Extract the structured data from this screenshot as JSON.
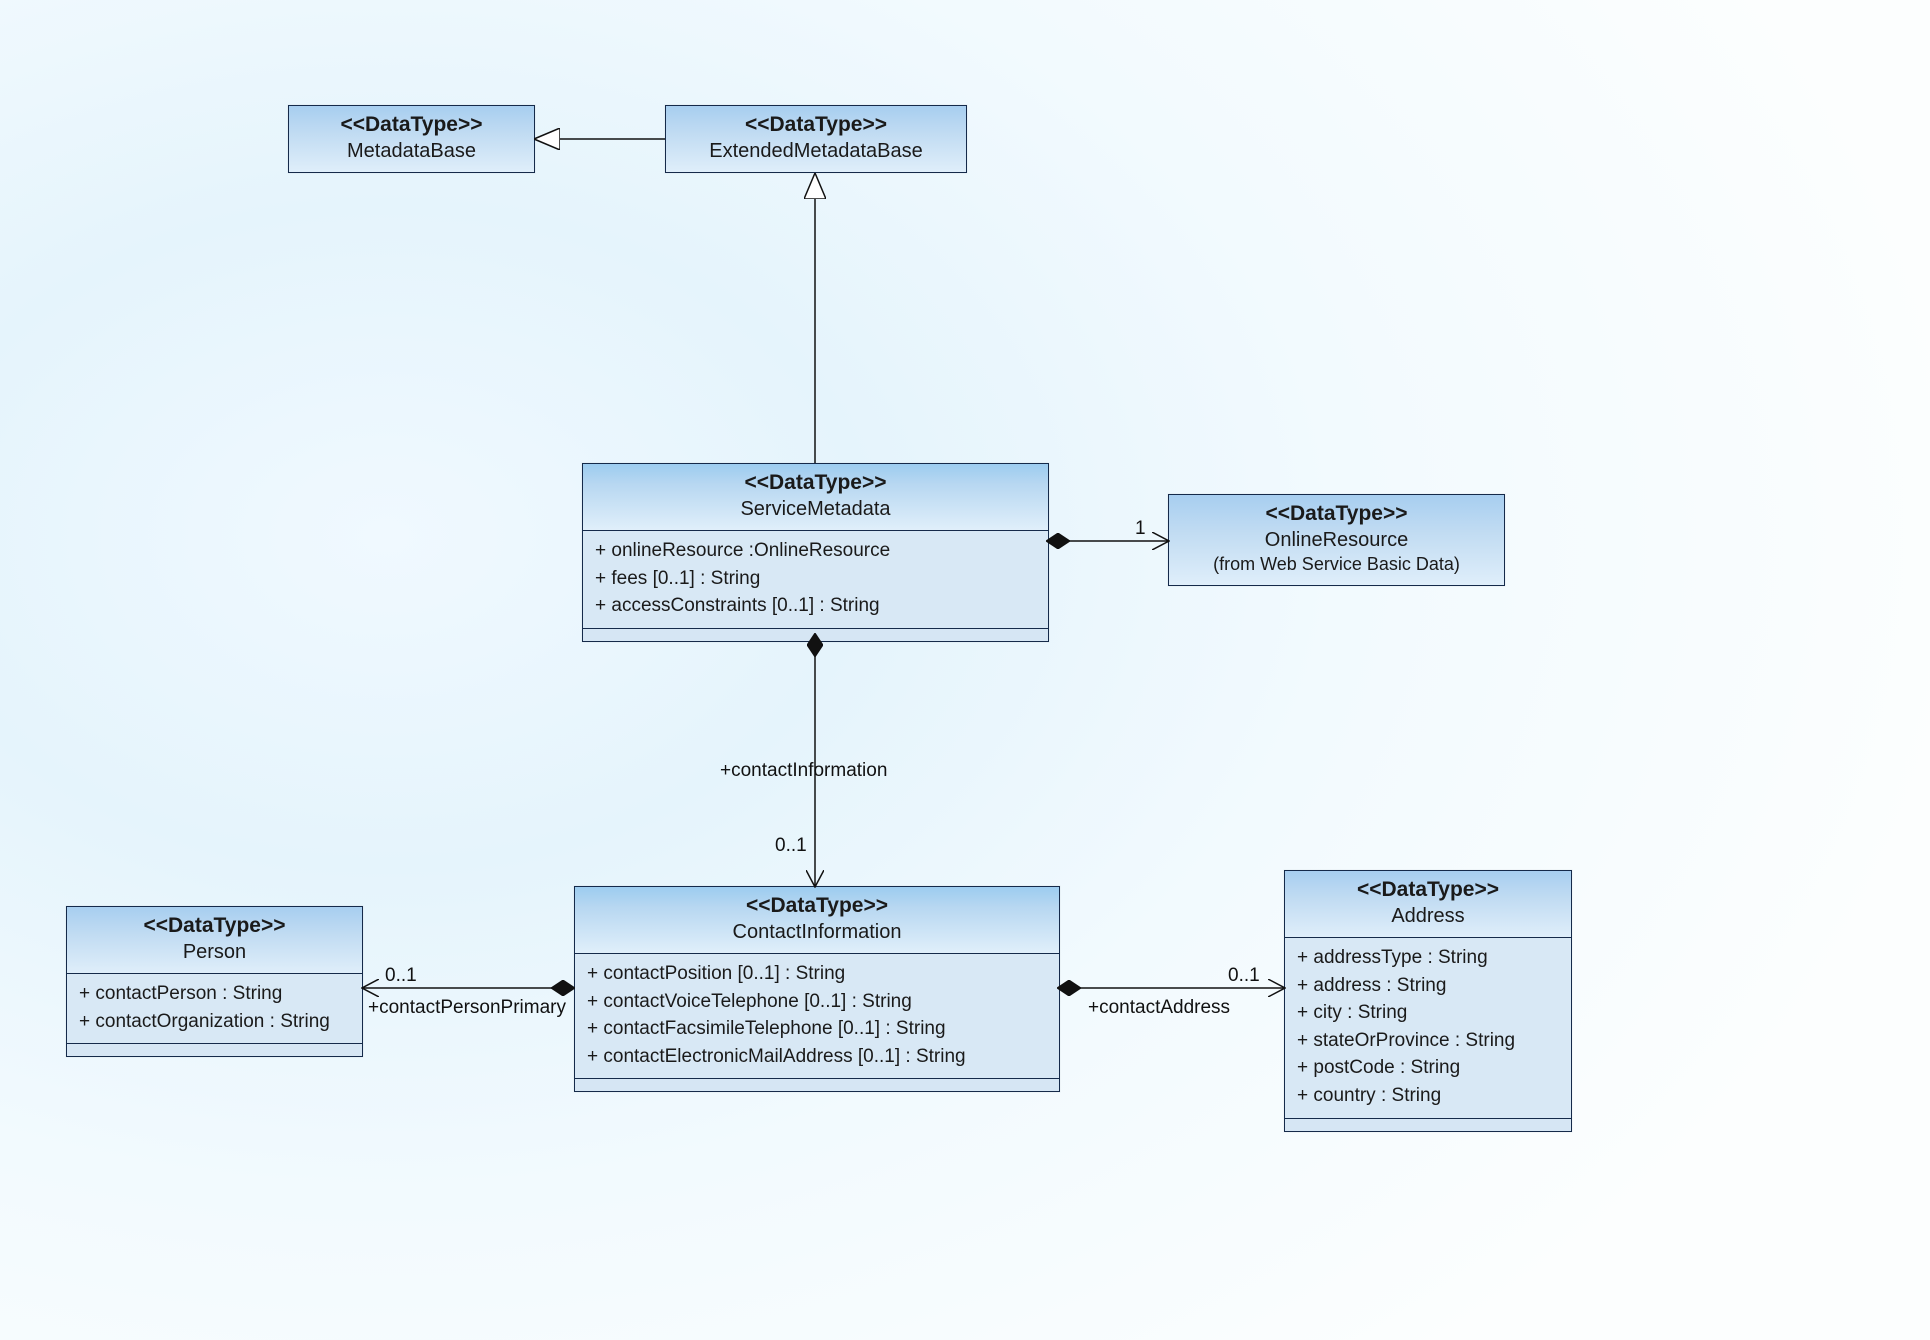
{
  "classes": {
    "metadataBase": {
      "stereotype": "<<DataType>>",
      "name": "MetadataBase"
    },
    "extendedMetadataBase": {
      "stereotype": "<<DataType>>",
      "name": "ExtendedMetadataBase"
    },
    "serviceMetadata": {
      "stereotype": "<<DataType>>",
      "name": "ServiceMetadata",
      "attrs": [
        "+ onlineResource :OnlineResource",
        "+ fees [0..1] : String",
        "+ accessConstraints [0..1] : String"
      ]
    },
    "onlineResource": {
      "stereotype": "<<DataType>>",
      "name": "OnlineResource",
      "note": "(from Web Service Basic Data)"
    },
    "contactInformation": {
      "stereotype": "<<DataType>>",
      "name": "ContactInformation",
      "attrs": [
        "+ contactPosition [0..1] : String",
        "+ contactVoiceTelephone [0..1] : String",
        "+ contactFacsimileTelephone [0..1] : String",
        "+ contactElectronicMailAddress [0..1] : String"
      ]
    },
    "person": {
      "stereotype": "<<DataType>>",
      "name": "Person",
      "attrs": [
        "+ contactPerson : String",
        "+ contactOrganization : String"
      ]
    },
    "address": {
      "stereotype": "<<DataType>>",
      "name": "Address",
      "attrs": [
        "+ addressType : String",
        "+ address : String",
        "+ city : String",
        "+ stateOrProvince : String",
        "+ postCode : String",
        "+ country : String"
      ]
    }
  },
  "labels": {
    "contactInformation_role": "+contactInformation",
    "contactInformation_mult": "0..1",
    "onlineResource_mult": "1",
    "person_mult": "0..1",
    "person_role": "+contactPersonPrimary",
    "address_mult": "0..1",
    "address_role": "+contactAddress"
  }
}
